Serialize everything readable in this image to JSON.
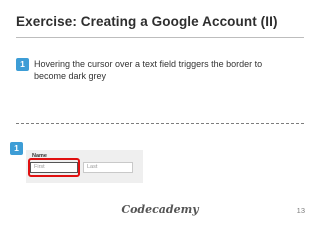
{
  "slide": {
    "title": "Exercise: Creating a Google Account (II)",
    "step_number": "1",
    "step_text": "Hovering the cursor over a text field triggers the border to become dark grey",
    "page_number": "13"
  },
  "screenshot": {
    "badge_number": "1",
    "name_label": "Name",
    "first_placeholder": "First",
    "last_placeholder": "Last"
  },
  "footer": {
    "logo": "Codecademy"
  },
  "colors": {
    "accent_badge": "#3d9dd6",
    "highlight": "#e01010",
    "hover_border": "#555555"
  }
}
